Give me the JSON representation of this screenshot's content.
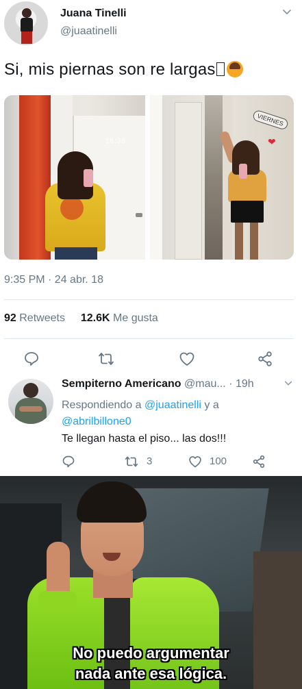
{
  "tweet": {
    "author_name": "Juana Tinelli",
    "author_handle": "@juaatinelli",
    "text": "Si, mis piernas son re largas",
    "timestamp": "9:35 PM · 24 abr. 18",
    "retweets_count": "92",
    "retweets_label": "Retweets",
    "likes_count": "12.6K",
    "likes_label": "Me gusta",
    "photo_left_clock": "18:38",
    "photo_right_sign": "VIERNES"
  },
  "reply": {
    "author_name": "Sempiterno Americano",
    "author_handle": "@mau...",
    "time": "· 19h",
    "replying_prefix": "Respondiendo a",
    "replying_user1": "@juaatinelli",
    "replying_join": "y a",
    "replying_user2": "@abrilbillone0",
    "text": "Te llegan hasta el piso... las dos!!!",
    "retweets": "3",
    "likes": "100"
  },
  "meme": {
    "caption_line1": "No puedo argumentar",
    "caption_line2": "nada ante esa lógica."
  },
  "colors": {
    "link": "#1da1f2",
    "muted": "#657786",
    "text": "#14171a"
  },
  "icons": [
    "chevron-down-icon",
    "reply-icon",
    "retweet-icon",
    "like-icon",
    "share-icon"
  ]
}
